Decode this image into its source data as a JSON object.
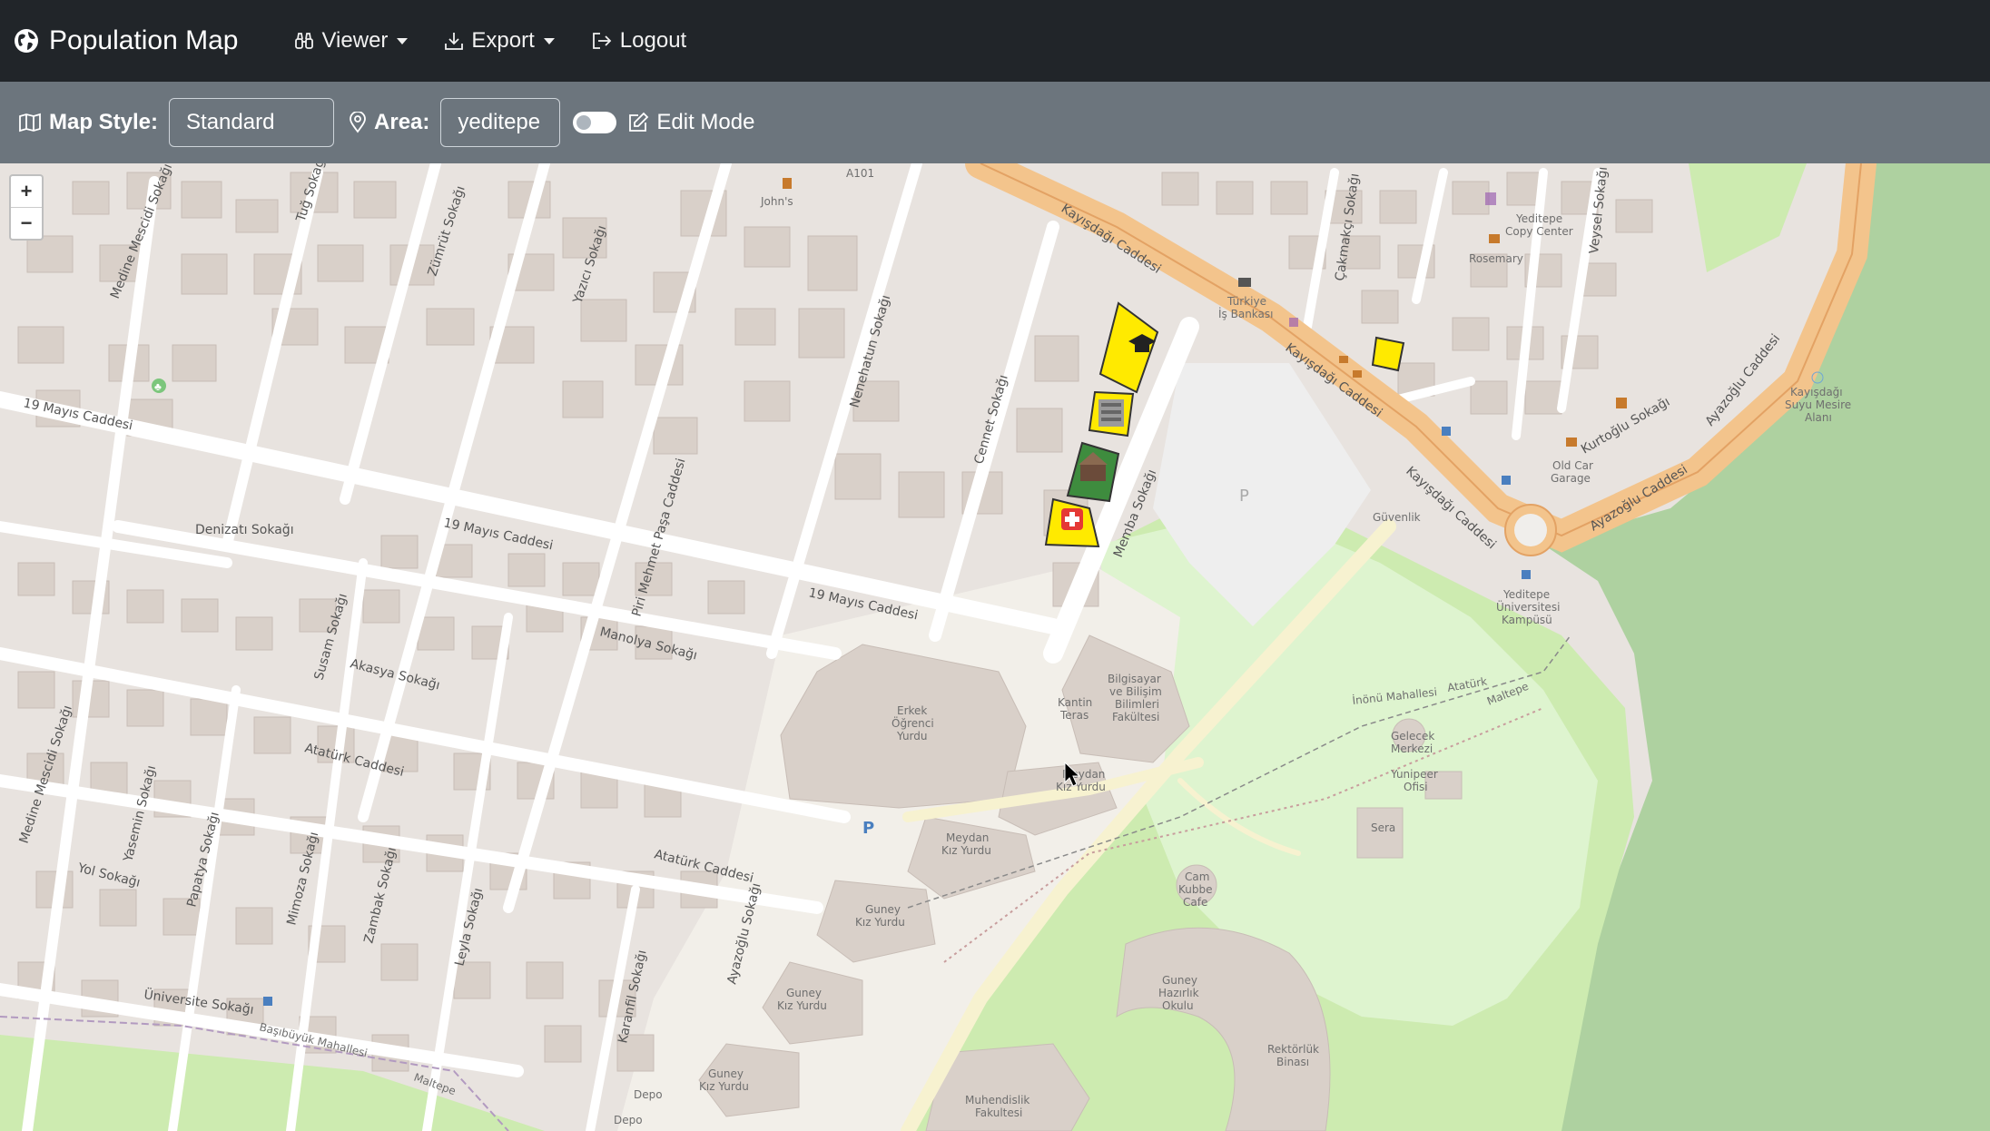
{
  "app": {
    "title": "Population Map",
    "logo_icon": "globe-icon"
  },
  "nav": {
    "viewer_label": "Viewer",
    "export_label": "Export",
    "logout_label": "Logout"
  },
  "toolbar": {
    "map_style_label": "Map Style:",
    "map_style_value": "Standard",
    "area_label": "Area:",
    "area_value": "yeditepe",
    "edit_mode_label": "Edit Mode",
    "edit_mode_on": false
  },
  "map": {
    "zoom_in": "+",
    "zoom_out": "−",
    "street_labels": {
      "medine_mescidi_1": "Medine Mescidi Sokağı",
      "tug": "Tuğ Sokağı",
      "zumrut": "Zümrüt Sokağı",
      "yazici": "Yazıcı Sokağı",
      "nenehatun": "Nenehatun Sokağı",
      "cennet": "Cennet Sokağı",
      "kayisdagi_1": "Kayışdağı Caddesi",
      "kayisdagi_2": "Kayışdağı Caddesi",
      "kayisdagi_3": "Kayışdağı Caddesi",
      "cakmakci": "Çakmakçı Sokağı",
      "veysel": "Veysel Sokağı",
      "ayazoglu_1": "Ayazoğlu Caddesi",
      "ayazoglu_2": "Ayazoğlu Caddesi",
      "kurtoglu": "Kurtoğlu Sokağı",
      "mayis19_1": "19 Mayıs Caddesi",
      "mayis19_2": "19 Mayıs Caddesi",
      "mayis19_3": "19 Mayıs Caddesi",
      "denizati": "Denizatı Sokağı",
      "piri": "Piri Mehmet Paşa Caddesi",
      "memba": "Memba Sokağı",
      "manolya": "Manolya Sokağı",
      "akasya": "Akasya Sokağı",
      "susam": "Susam Sokağı",
      "ataturk_1": "Atatürk Caddesi",
      "ataturk_2": "Atatürk Caddesi",
      "medine_mescidi_2": "Medine Mescidi Sokağı",
      "yasemin": "Yasemin Sokağı",
      "papatya": "Papatya Sokağı",
      "mimoza": "Mimoza Sokağı",
      "zambak": "Zambak Sokağı",
      "leyla": "Leyla Sokağı",
      "ayazoglu_sok": "Ayazoğlu Sokağı",
      "karanfil": "Karanfil Sokağı",
      "yol": "Yol Sokağı",
      "universite": "Üniversite Sokağı",
      "basibuyuk": "Başıbüyük Mahallesi",
      "maltepe": "Maltepe"
    },
    "place_labels": {
      "a101": "A101",
      "johns": "John's",
      "turkiye_is_1": "Türkiye",
      "turkiye_is_2": "İş Bankası",
      "copy_center_1": "Yeditepe",
      "copy_center_2": "Copy Center",
      "rosemary": "Rosemary",
      "old_car_1": "Old Car",
      "old_car_2": "Garage",
      "korusu_1": "Kayışdağı",
      "korusu_2": "Suyu Mesire",
      "korusu_3": "Alanı",
      "guvenlik": "Güvenlik",
      "parking_1": "P",
      "parking_2": "P",
      "yeditepe_1": "Yeditepe",
      "yeditepe_2": "Üniversitesi",
      "yeditepe_3": "Kampüsü",
      "inonu_1": "İnönü Mahallesi",
      "inonu_2": "Atatürk",
      "inonu_3": "Maltepe",
      "erkek_1": "Erkek",
      "erkek_2": "Öğrenci",
      "erkek_3": "Yurdu",
      "kantin_1": "Kantin",
      "kantin_2": "Teras",
      "bilgisayar_1": "Bilgisayar",
      "bilgisayar_2": "ve Bilişim",
      "bilgisayar_3": "Bilimleri",
      "bilgisayar_4": "Fakültesi",
      "meydan_1a": "Meydan",
      "meydan_1b": "Kız Yurdu",
      "meydan_2a": "Meydan",
      "meydan_2b": "Kız Yurdu",
      "gelecek_1": "Gelecek",
      "gelecek_2": "Merkezi",
      "yunipeer_1": "Yunipeer",
      "yunipeer_2": "Ofisi",
      "sera": "Sera",
      "cam_1": "Cam",
      "cam_2": "Kubbe",
      "cam_3": "Cafe",
      "guney_1a": "Guney",
      "guney_1b": "Kız Yurdu",
      "guney_2a": "Guney",
      "guney_2b": "Kız Yurdu",
      "guney_3a": "Guney",
      "guney_3b": "Kız Yurdu",
      "guney_hazirlik_1": "Guney",
      "guney_hazirlik_2": "Hazırlık",
      "guney_hazirlik_3": "Okulu",
      "rektorluk_1": "Rektörlük",
      "rektorluk_2": "Binası",
      "muhendislik_1": "Muhendislik",
      "muhendislik_2": "Fakultesi",
      "depo_1": "Depo",
      "depo_2": "Depo"
    },
    "markers": [
      "graduation-cap-icon",
      "building-photo-icon",
      "house-photo-icon",
      "hospital-cross-icon",
      "area-marker"
    ]
  }
}
